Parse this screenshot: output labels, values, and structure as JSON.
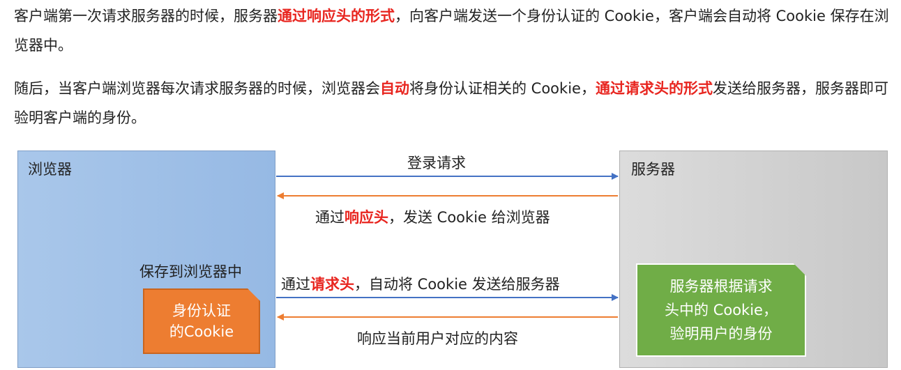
{
  "paragraphs": {
    "p1": {
      "before": "客户端第一次请求服务器的时候，服务器",
      "highlight": "通过响应头的形式",
      "after": "，向客户端发送一个身份认证的 Cookie，客户端会自动将 Cookie 保存在浏览器中。"
    },
    "p2": {
      "before": "随后，当客户端浏览器每次请求服务器的时候，浏览器会",
      "highlight1": "自动",
      "middle": "将身份认证相关的 Cookie，",
      "highlight2": "通过请求头的形式",
      "after": "发送给服务器，服务器即可验明客户端的身份。"
    }
  },
  "diagram": {
    "browser_title": "浏览器",
    "server_title": "服务器",
    "save_label": "保存到浏览器中",
    "cookie_note": {
      "line1": "身份认证",
      "line2": "的Cookie"
    },
    "server_note": {
      "line1": "服务器根据请求",
      "line2": "头中的 Cookie，",
      "line3": "验明用户的身份"
    },
    "arrow1_label": "登录请求",
    "arrow2_label": {
      "before": "通过",
      "highlight": "响应头",
      "after": "，发送 Cookie 给浏览器"
    },
    "arrow3_label": {
      "before": "通过",
      "highlight": "请求头",
      "after": "，自动将 Cookie 发送给服务器"
    },
    "arrow4_label": "响应当前用户对应的内容",
    "colors": {
      "request_arrow": "#4472c4",
      "response_arrow": "#ed7d31",
      "highlight": "#e8251f"
    }
  }
}
